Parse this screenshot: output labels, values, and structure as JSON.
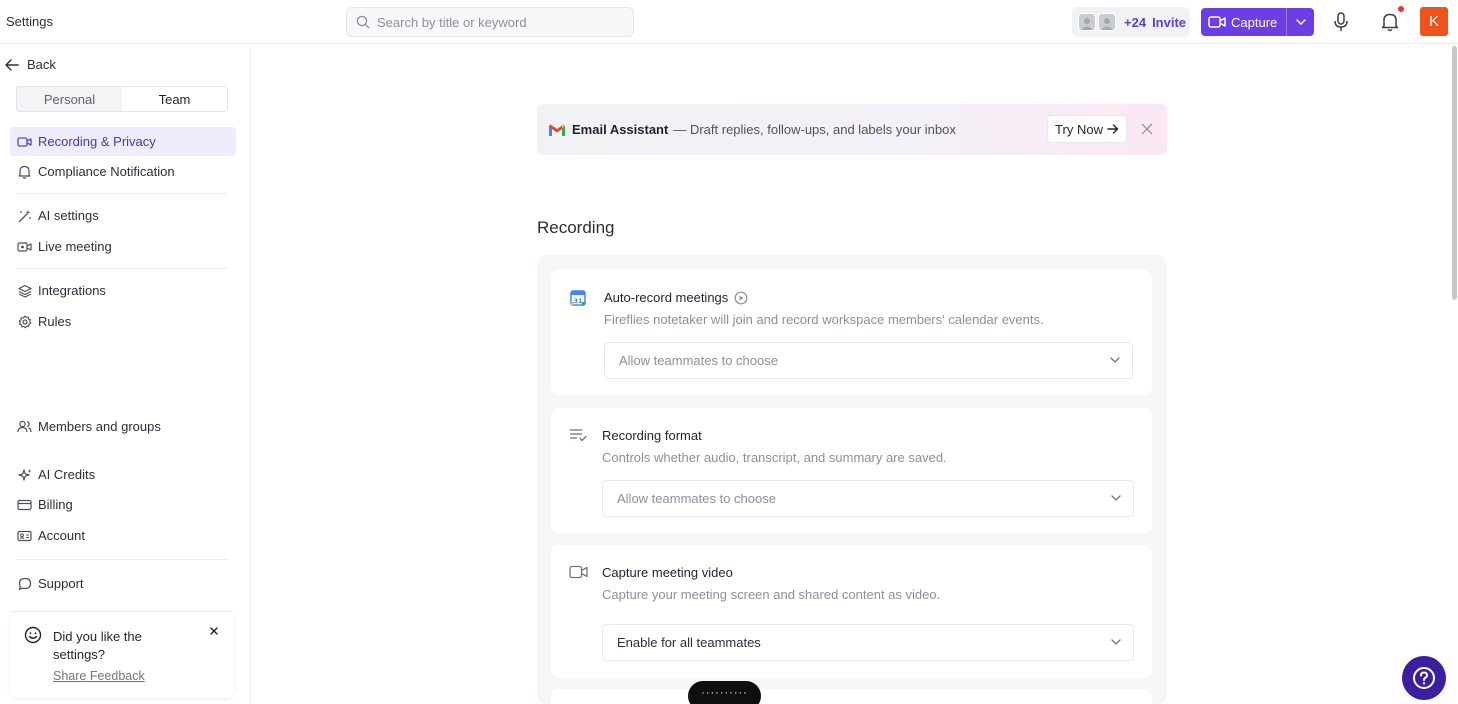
{
  "header": {
    "title": "Settings",
    "search_placeholder": "Search by title or keyword",
    "invite_count": "+24",
    "invite_label": "Invite",
    "capture_label": "Capture",
    "user_initial": "K"
  },
  "sidebar": {
    "back_label": "Back",
    "tabs": [
      "Personal",
      "Team"
    ],
    "active_tab": "Team",
    "items": [
      {
        "label": "Recording & Privacy",
        "icon": "video-icon",
        "active": true
      },
      {
        "label": "Compliance Notification",
        "icon": "bell-icon"
      },
      {
        "label": "AI settings",
        "icon": "magic-wand-icon"
      },
      {
        "label": "Live meeting",
        "icon": "live-video-icon"
      },
      {
        "label": "Integrations",
        "icon": "layers-icon"
      },
      {
        "label": "Rules",
        "icon": "gear-icon"
      },
      {
        "label": "Members and groups",
        "icon": "users-icon"
      },
      {
        "label": "AI Credits",
        "icon": "sparkle-icon"
      },
      {
        "label": "Billing",
        "icon": "credit-card-icon"
      },
      {
        "label": "Account",
        "icon": "id-card-icon"
      },
      {
        "label": "Support",
        "icon": "chat-bubble-icon"
      }
    ],
    "feedback": {
      "text": "Did you like the settings?",
      "link": "Share Feedback"
    }
  },
  "banner": {
    "title": "Email Assistant",
    "description": "— Draft replies, follow-ups, and labels your inbox",
    "button": "Try Now"
  },
  "main": {
    "section_title": "Recording",
    "cards": [
      {
        "title": "Auto-record meetings",
        "description": "Fireflies notetaker will join and record workspace members' calendar events.",
        "select_value": "Allow teammates to choose",
        "icon": "calendar-icon"
      },
      {
        "title": "Recording format",
        "description": "Controls whether audio, transcript, and summary are saved.",
        "select_value": "Allow teammates to choose",
        "icon": "list-check-icon"
      },
      {
        "title": "Capture meeting video",
        "description": "Capture your meeting screen and shared content as video.",
        "select_value": "Enable for all teammates",
        "icon": "video-camera-icon"
      }
    ]
  },
  "colors": {
    "accent": "#6b3ee6",
    "active_nav_bg": "#efecfd",
    "avatar": "#f0521c",
    "help_button": "#3b1fa0"
  }
}
